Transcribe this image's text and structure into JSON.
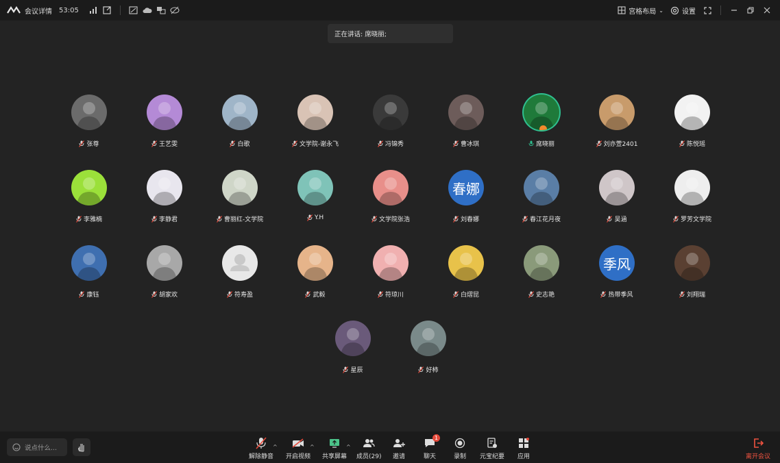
{
  "topbar": {
    "meeting_details": "会议详情",
    "timer": "53:05",
    "layout_label": "宫格布局",
    "settings_label": "设置"
  },
  "speaking": {
    "label": "正在讲话: 席晓丽;"
  },
  "participants": [
    {
      "name": "张尊",
      "color": "#6b6b6b",
      "muted": true
    },
    {
      "name": "王艺雯",
      "color": "#b48ad6",
      "muted": true
    },
    {
      "name": "白歌",
      "color": "#9fb5c8",
      "muted": true
    },
    {
      "name": "文学院-谢永飞",
      "color": "#d9c3b5",
      "muted": true
    },
    {
      "name": "冯锦秀",
      "color": "#3a3a3a",
      "muted": true
    },
    {
      "name": "曹冰琪",
      "color": "#6d5c5a",
      "muted": true
    },
    {
      "name": "席晓丽",
      "color": "#1f7a3a",
      "muted": false,
      "active": true
    },
    {
      "name": "刘亦萱2401",
      "color": "#c89b6b",
      "muted": true
    },
    {
      "name": "陈悦瑶",
      "color": "#f2f2f2",
      "muted": true
    },
    {
      "name": "李雅楠",
      "color": "#9be03a",
      "muted": true
    },
    {
      "name": "李静君",
      "color": "#e8e6ee",
      "muted": true
    },
    {
      "name": "曹丽红-文学院",
      "color": "#cfd6c8",
      "muted": true
    },
    {
      "name": "Y.H",
      "color": "#7fc3b8",
      "muted": true
    },
    {
      "name": "文学院张浩",
      "color": "#e88f8a",
      "muted": true
    },
    {
      "name": "刘春娜",
      "color": "#2f6fc6",
      "muted": true,
      "initials": "春娜"
    },
    {
      "name": "春江花月夜",
      "color": "#5a7ea6",
      "muted": true
    },
    {
      "name": "吴涵",
      "color": "#cfc6c8",
      "muted": true
    },
    {
      "name": "罗芳文学院",
      "color": "#eeeeee",
      "muted": true
    },
    {
      "name": "康钰",
      "color": "#3f6fb0",
      "muted": true
    },
    {
      "name": "胡家欢",
      "color": "#a8a8a8",
      "muted": true
    },
    {
      "name": "符寿盈",
      "color": "#e8e8e8",
      "muted": true,
      "placeholder": true
    },
    {
      "name": "武毅",
      "color": "#e6b48a",
      "muted": true
    },
    {
      "name": "符琼川",
      "color": "#f0b0b0",
      "muted": true
    },
    {
      "name": "白熠昆",
      "color": "#e8c24a",
      "muted": true
    },
    {
      "name": "史志艳",
      "color": "#8a9a7a",
      "muted": true
    },
    {
      "name": "热带季风",
      "color": "#2f6fc6",
      "muted": true,
      "initials": "季风"
    },
    {
      "name": "刘翔瑞",
      "color": "#5a4032",
      "muted": true
    },
    {
      "name": "星辰",
      "color": "#6a5a7a",
      "muted": true
    },
    {
      "name": "好柿",
      "color": "#7a8a8a",
      "muted": true
    }
  ],
  "bottombar": {
    "say_placeholder": "说点什么...",
    "unmute": "解除静音",
    "start_video": "开启视频",
    "share_screen": "共享屏幕",
    "members": "成员(29)",
    "invite": "邀请",
    "chat": "聊天",
    "chat_badge": "1",
    "record": "录制",
    "yuanbao": "元宝纪要",
    "apps": "应用",
    "leave": "离开会议"
  }
}
